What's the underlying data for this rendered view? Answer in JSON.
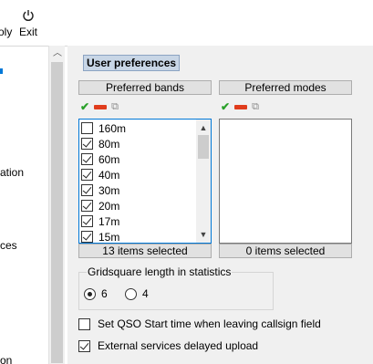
{
  "toolbar": {
    "apply_label": "oly",
    "exit_icon": "power-icon",
    "exit_label": "Exit"
  },
  "sidebar": {
    "items": [
      "ation",
      "ces",
      "on"
    ]
  },
  "preferences": {
    "title": "User preferences",
    "bands": {
      "header": "Preferred bands",
      "items": [
        {
          "label": "160m",
          "checked": false
        },
        {
          "label": "80m",
          "checked": true
        },
        {
          "label": "60m",
          "checked": true
        },
        {
          "label": "40m",
          "checked": true
        },
        {
          "label": "30m",
          "checked": true
        },
        {
          "label": "20m",
          "checked": true
        },
        {
          "label": "17m",
          "checked": true
        },
        {
          "label": "15m",
          "checked": true
        }
      ],
      "footer": "13 items selected"
    },
    "modes": {
      "header": "Preferred modes",
      "items": [],
      "footer": "0 items selected"
    },
    "gridsquare": {
      "title": "Gridsquare length in statistics",
      "options": [
        {
          "label": "6",
          "checked": true
        },
        {
          "label": "4",
          "checked": false
        }
      ]
    },
    "options": [
      {
        "label": "Set QSO Start time when leaving callsign field",
        "checked": false
      },
      {
        "label": "External services delayed upload",
        "checked": true
      }
    ]
  },
  "colors": {
    "check_green": "#2aa12a",
    "remove_red": "#e03c1c",
    "focus_blue": "#0078d7",
    "title_bg": "#c8d6e6"
  }
}
